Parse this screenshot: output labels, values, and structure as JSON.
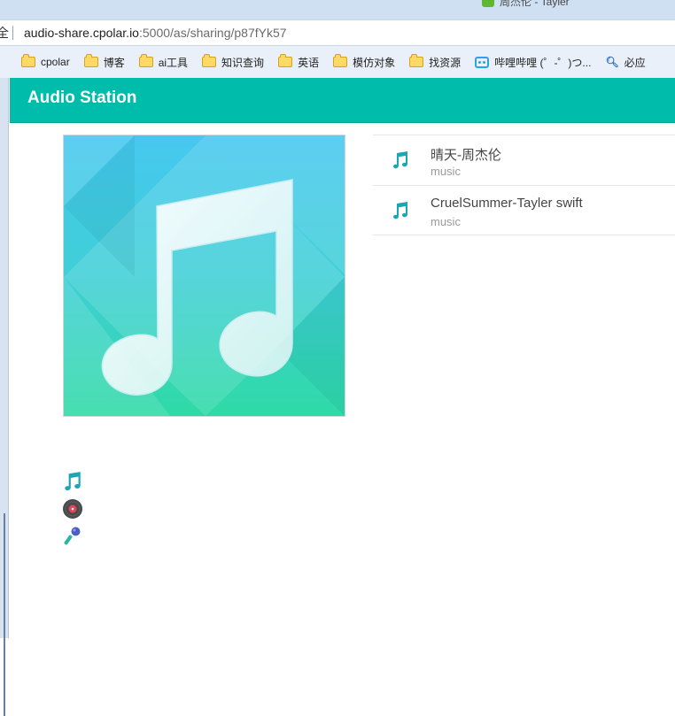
{
  "browser": {
    "tab_fragment": "周杰伦 - Tayler",
    "url_cut": "全",
    "url_host": "audio-share.cpolar.io",
    "url_rest": ":5000/as/sharing/p87fYk57",
    "bookmarks": [
      {
        "label": "cpolar",
        "icon": "folder-icon"
      },
      {
        "label": "博客",
        "icon": "folder-icon"
      },
      {
        "label": "ai工具",
        "icon": "folder-icon"
      },
      {
        "label": "知识查询",
        "icon": "folder-icon"
      },
      {
        "label": "英语",
        "icon": "folder-icon"
      },
      {
        "label": "模仿对象",
        "icon": "folder-icon"
      },
      {
        "label": "找资源",
        "icon": "folder-icon"
      },
      {
        "label": "哔哩哔哩 (゜-゜)つ...",
        "icon": "bilibili-icon"
      },
      {
        "label": "必应",
        "icon": "search-icon"
      }
    ]
  },
  "app": {
    "title": "Audio Station",
    "accent_color": "#00bcaa",
    "tracks": [
      {
        "title": "晴天-周杰伦",
        "subtitle": "music"
      },
      {
        "title": "CruelSummer-Tayler swift",
        "subtitle": "music"
      }
    ],
    "side_icons": [
      "music-note-icon",
      "vinyl-disc-icon",
      "microphone-icon"
    ]
  }
}
